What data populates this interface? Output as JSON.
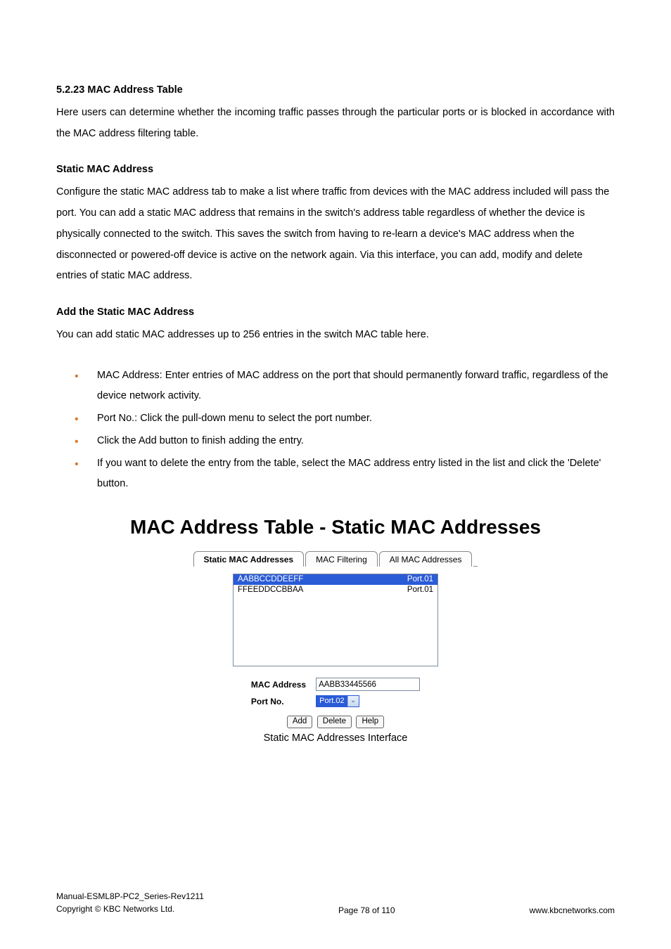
{
  "section": {
    "heading1": "5.2.23 MAC Address Table",
    "para1": "Here users can determine whether the incoming traffic passes through the particular ports or is blocked in accordance with the MAC address filtering table.",
    "heading2": "Static MAC Address",
    "para2": "Configure the static MAC address tab to make a list where traffic from devices with the MAC address included will pass the port. You can add a static MAC address that remains in the switch's address table regardless of whether the device is physically connected to the switch. This saves the switch from having to re-learn a device's MAC address when the disconnected or powered-off device is active on the network again. Via this interface, you can add, modify and delete entries of static MAC address.",
    "heading3": "Add the Static MAC Address",
    "para3": "You can add static MAC addresses up to 256 entries in the switch MAC table here.",
    "bullets": [
      "MAC Address: Enter entries of MAC address on the port that should permanently forward traffic, regardless of the device network activity.",
      "Port No.: Click the pull-down menu to select the port number.",
      "Click the Add button to finish adding the entry.",
      "If you want to delete the entry from the table, select the MAC address entry listed in the list and click the 'Delete' button."
    ]
  },
  "figure": {
    "title": "MAC Address Table - Static MAC Addresses",
    "tabs": {
      "active": "Static MAC Addresses",
      "t2": "MAC Filtering",
      "t3": "All MAC Addresses"
    },
    "listbox": {
      "rows": [
        {
          "mac": "AABBCCDDEEFF",
          "port": "Port.01",
          "selected": true
        },
        {
          "mac": "FFEEDDCCBBAA",
          "port": "Port.01",
          "selected": false
        }
      ]
    },
    "form": {
      "mac_label": "MAC Address",
      "mac_value": "AABB33445566",
      "port_label": "Port No.",
      "port_value": "Port.02"
    },
    "buttons": {
      "add": "Add",
      "delete": "Delete",
      "help": "Help"
    },
    "caption": "Static MAC Addresses Interface"
  },
  "footer": {
    "left1": "Manual-ESML8P-PC2_Series-Rev1211",
    "left2": "Copyright © KBC Networks Ltd.",
    "center": "Page 78 of 110",
    "right": "www.kbcnetworks.com"
  }
}
